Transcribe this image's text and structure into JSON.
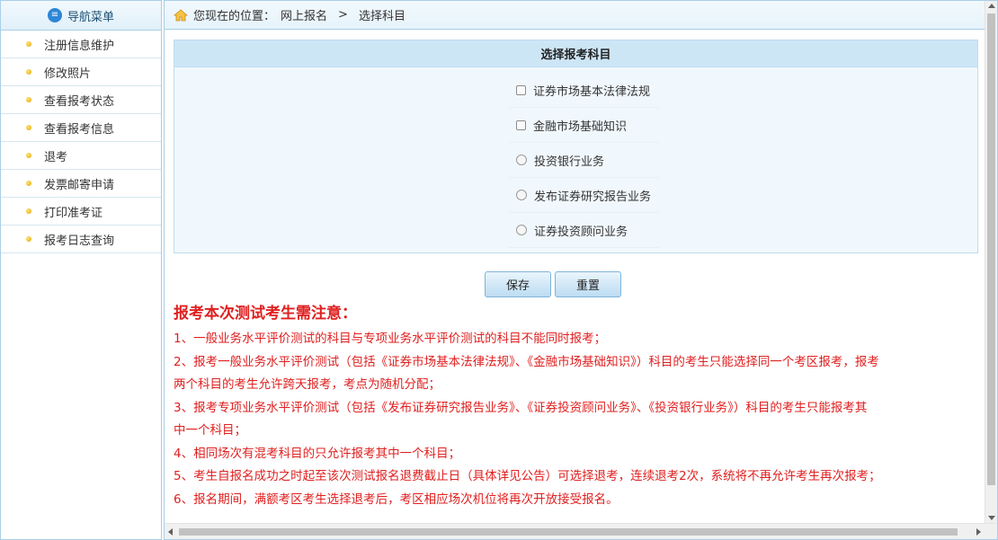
{
  "sidebar": {
    "title": "导航菜单",
    "icon": "menu-list-icon",
    "items": [
      {
        "label": "注册信息维护"
      },
      {
        "label": "修改照片"
      },
      {
        "label": "查看报考状态"
      },
      {
        "label": "查看报考信息"
      },
      {
        "label": "退考"
      },
      {
        "label": "发票邮寄申请"
      },
      {
        "label": "打印准考证"
      },
      {
        "label": "报考日志查询"
      }
    ]
  },
  "breadcrumb": {
    "prefix": "您现在的位置：",
    "level1": "网上报名",
    "separator": ">",
    "level2": "选择科目"
  },
  "subject_panel": {
    "title": "选择报考科目",
    "options": [
      {
        "type": "checkbox",
        "label": "证券市场基本法律法规",
        "checked": false
      },
      {
        "type": "checkbox",
        "label": "金融市场基础知识",
        "checked": false
      },
      {
        "type": "radio",
        "label": "投资银行业务",
        "checked": false
      },
      {
        "type": "radio",
        "label": "发布证券研究报告业务",
        "checked": false
      },
      {
        "type": "radio",
        "label": "证券投资顾问业务",
        "checked": false
      }
    ]
  },
  "buttons": {
    "save": "保存",
    "reset": "重置"
  },
  "notice": {
    "title": "报考本次测试考生需注意：",
    "lines": [
      "1、一般业务水平评价测试的科目与专项业务水平评价测试的科目不能同时报考；",
      "2、报考一般业务水平评价测试（包括《证券市场基本法律法规》、《金融市场基础知识》）科目的考生只能选择同一个考区报考，报考",
      "两个科目的考生允许跨天报考，考点为随机分配；",
      "3、报考专项业务水平评价测试（包括《发布证券研究报告业务》、《证券投资顾问业务》、《投资银行业务》）科目的考生只能报考其",
      "中一个科目；",
      "4、相同场次有混考科目的只允许报考其中一个科目；",
      "5、考生自报名成功之时起至该次测试报名退费截止日（具体详见公告）可选择退考，连续退考2次，系统将不再允许考生再次报考；",
      "6、报名期间，满额考区考生选择退考后，考区相应场次机位将再次开放接受报名。"
    ],
    "color": "#e02020"
  },
  "colors": {
    "border": "#a9cfe6",
    "panel_header": "#cde6f6",
    "panel_bg": "#f1f8fd",
    "notice": "#e02020"
  }
}
